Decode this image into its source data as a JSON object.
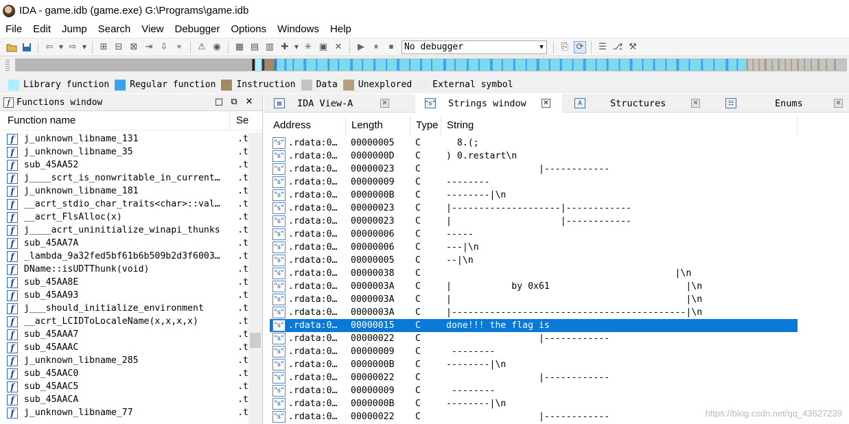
{
  "window": {
    "title": "IDA - game.idb (game.exe) G:\\Programs\\game.idb"
  },
  "menu": [
    "File",
    "Edit",
    "Jump",
    "Search",
    "View",
    "Debugger",
    "Options",
    "Windows",
    "Help"
  ],
  "toolbar": {
    "debugger_select": "No debugger"
  },
  "legend": [
    {
      "label": "Library function",
      "color": "#a8f0ff"
    },
    {
      "label": "Regular function",
      "color": "#3aa4ec"
    },
    {
      "label": "Instruction",
      "color": "#a08c64"
    },
    {
      "label": "Data",
      "color": "#c4c4c4"
    },
    {
      "label": "Unexplored",
      "color": "#b4a080"
    },
    {
      "label": "External symbol",
      "color": "#eeeeee"
    }
  ],
  "functions_window": {
    "title": "Functions window",
    "col_name": "Function name",
    "col_segment": "Se",
    "rows": [
      {
        "name": "j_unknown_libname_131",
        "seg": ".t"
      },
      {
        "name": "j_unknown_libname_35",
        "seg": ".t"
      },
      {
        "name": "sub_45AA52",
        "seg": ".t"
      },
      {
        "name": "j____scrt_is_nonwritable_in_current…",
        "seg": ".t"
      },
      {
        "name": "j_unknown_libname_181",
        "seg": ".t"
      },
      {
        "name": "__acrt_stdio_char_traits<char>::val…",
        "seg": ".t"
      },
      {
        "name": "__acrt_FlsAlloc(x)",
        "seg": ".t"
      },
      {
        "name": "j____acrt_uninitialize_winapi_thunks",
        "seg": ".t"
      },
      {
        "name": "sub_45AA7A",
        "seg": ".t"
      },
      {
        "name": "_lambda_9a32fed5bf61b6b509b2d3f6003…",
        "seg": ".t"
      },
      {
        "name": "DName::isUDTThunk(void)",
        "seg": ".t"
      },
      {
        "name": "sub_45AA8E",
        "seg": ".t"
      },
      {
        "name": "sub_45AA93",
        "seg": ".t"
      },
      {
        "name": "j___should_initialize_environment",
        "seg": ".t"
      },
      {
        "name": "__acrt_LCIDToLocaleName(x,x,x,x)",
        "seg": ".t"
      },
      {
        "name": "sub_45AAA7",
        "seg": ".t"
      },
      {
        "name": "sub_45AAAC",
        "seg": ".t"
      },
      {
        "name": "j_unknown_libname_285",
        "seg": ".t"
      },
      {
        "name": "sub_45AAC0",
        "seg": ".t"
      },
      {
        "name": "sub_45AAC5",
        "seg": ".t"
      },
      {
        "name": "sub_45AACA",
        "seg": ".t"
      },
      {
        "name": "j_unknown_libname_77",
        "seg": ".t"
      }
    ]
  },
  "tabs": [
    {
      "label": "IDA View-A"
    },
    {
      "label": "Strings window"
    },
    {
      "label": "Structures"
    },
    {
      "label": "Enums"
    }
  ],
  "strings_window": {
    "columns": [
      "Address",
      "Length",
      "Type",
      "String"
    ],
    "rows": [
      {
        "addr": ".rdata:0…",
        "len": "00000005",
        "type": "C",
        "str": "  8.(;"
      },
      {
        "addr": ".rdata:0…",
        "len": "0000000D",
        "type": "C",
        "str": ") 0.restart\\n"
      },
      {
        "addr": ".rdata:0…",
        "len": "00000023",
        "type": "C",
        "str": "                 |------------"
      },
      {
        "addr": ".rdata:0…",
        "len": "00000009",
        "type": "C",
        "str": "--------"
      },
      {
        "addr": ".rdata:0…",
        "len": "0000000B",
        "type": "C",
        "str": "--------|\\n"
      },
      {
        "addr": ".rdata:0…",
        "len": "00000023",
        "type": "C",
        "str": "|--------------------|------------"
      },
      {
        "addr": ".rdata:0…",
        "len": "00000023",
        "type": "C",
        "str": "|                    |------------"
      },
      {
        "addr": ".rdata:0…",
        "len": "00000006",
        "type": "C",
        "str": "-----"
      },
      {
        "addr": ".rdata:0…",
        "len": "00000006",
        "type": "C",
        "str": "---|\\n"
      },
      {
        "addr": ".rdata:0…",
        "len": "00000005",
        "type": "C",
        "str": "--|\\n"
      },
      {
        "addr": ".rdata:0…",
        "len": "00000038",
        "type": "C",
        "str": "                                          |\\n"
      },
      {
        "addr": ".rdata:0…",
        "len": "0000003A",
        "type": "C",
        "str": "|           by 0x61                         |\\n"
      },
      {
        "addr": ".rdata:0…",
        "len": "0000003A",
        "type": "C",
        "str": "|                                           |\\n"
      },
      {
        "addr": ".rdata:0…",
        "len": "0000003A",
        "type": "C",
        "str": "|-------------------------------------------|\\n"
      },
      {
        "addr": ".rdata:0…",
        "len": "00000015",
        "type": "C",
        "str": "done!!! the flag is",
        "selected": true
      },
      {
        "addr": ".rdata:0…",
        "len": "00000022",
        "type": "C",
        "str": "                 |------------"
      },
      {
        "addr": ".rdata:0…",
        "len": "00000009",
        "type": "C",
        "str": " --------"
      },
      {
        "addr": ".rdata:0…",
        "len": "0000000B",
        "type": "C",
        "str": "--------|\\n"
      },
      {
        "addr": ".rdata:0…",
        "len": "00000022",
        "type": "C",
        "str": "                 |------------"
      },
      {
        "addr": ".rdata:0…",
        "len": "00000009",
        "type": "C",
        "str": " --------"
      },
      {
        "addr": ".rdata:0…",
        "len": "0000000B",
        "type": "C",
        "str": "--------|\\n"
      },
      {
        "addr": ".rdata:0…",
        "len": "00000022",
        "type": "C",
        "str": "                 |------------"
      }
    ]
  },
  "watermark": "https://blog.csdn.net/qq_43627239"
}
